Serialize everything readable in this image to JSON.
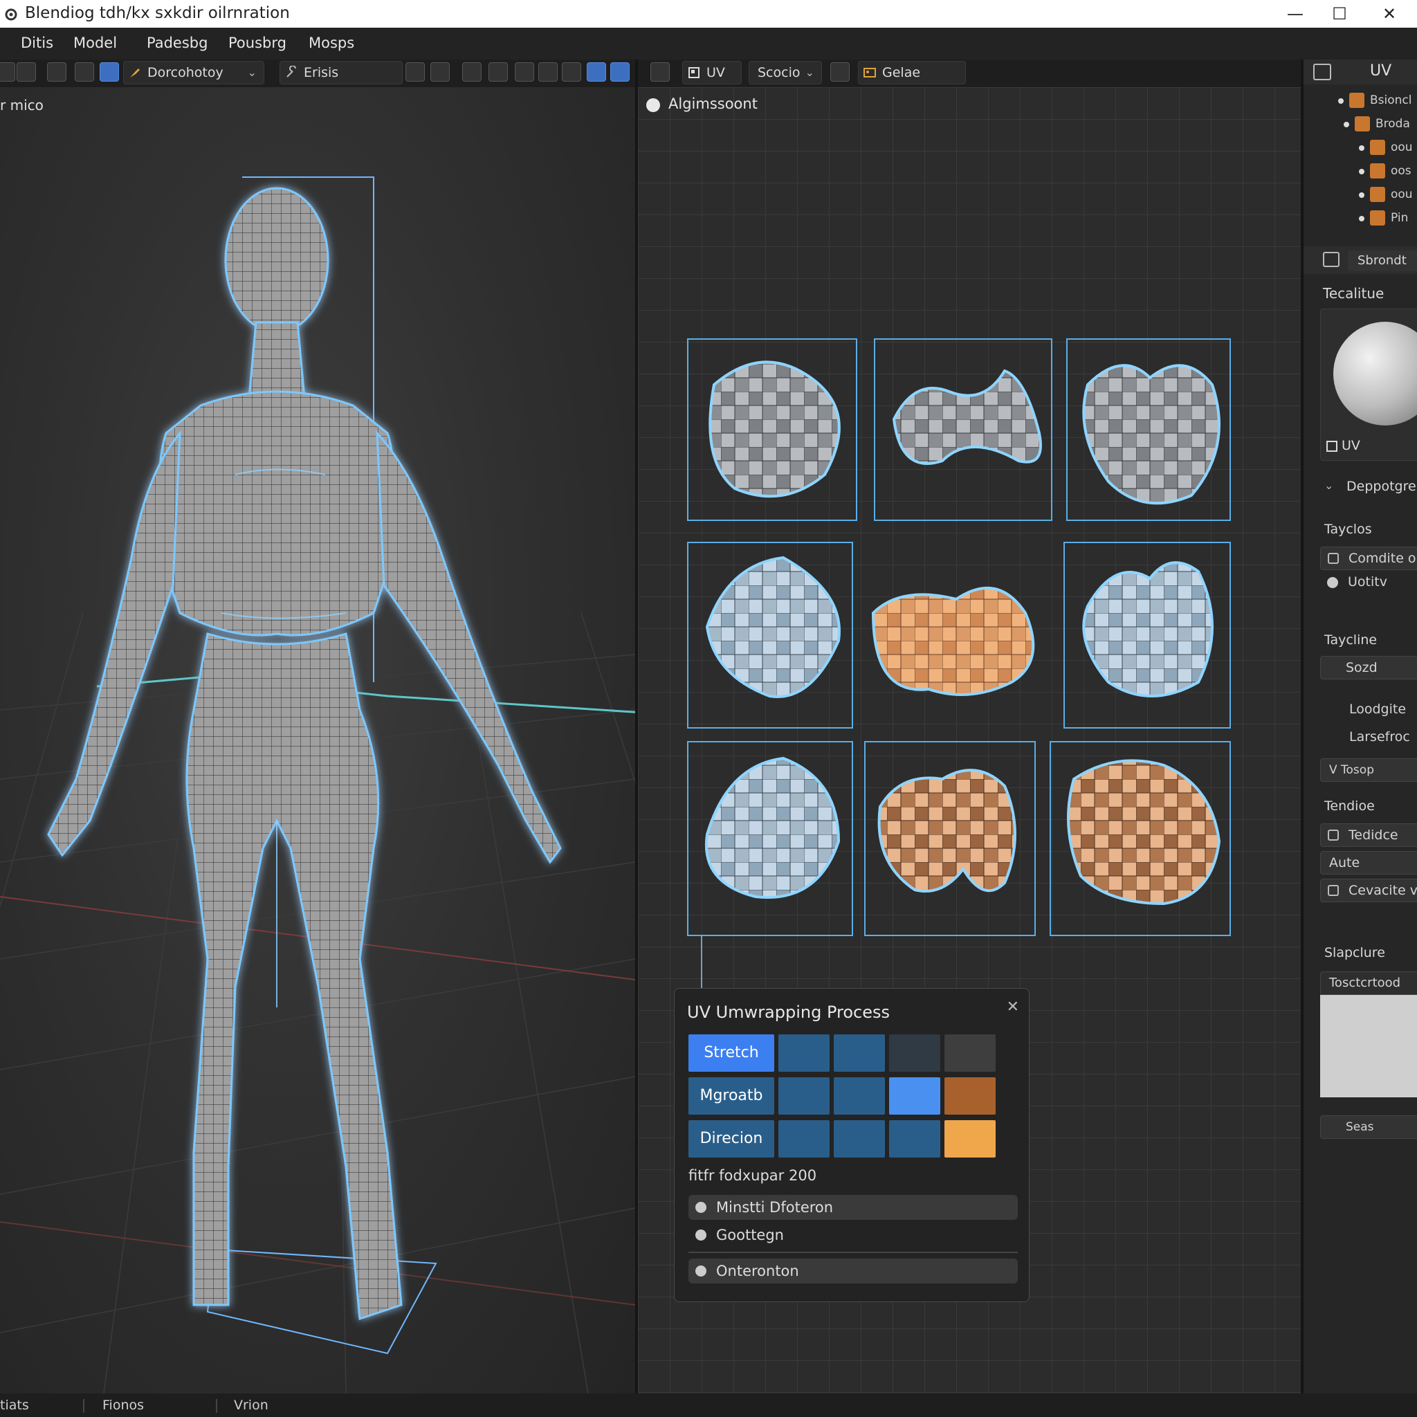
{
  "window": {
    "title": "Blendiog tdh/kx sxkdir oilrnration",
    "minimize": "—",
    "maximize": "☐",
    "close": "✕"
  },
  "menu": [
    "Ditis",
    "Model",
    "Padesbg",
    "Pousbrg",
    "Mosps"
  ],
  "toolbar": {
    "mode_label": "Dorcohotoy",
    "tool_label": "Erisis",
    "uv_label": "UV",
    "select_label": "Scocio",
    "extra_label": "Gelae"
  },
  "viewport": {
    "label": "r mico"
  },
  "uv_editor": {
    "label": "Algimssoont"
  },
  "uv_panel": {
    "title": "UV Umwrapping Process",
    "rows": [
      "Stretch",
      "Mgroatb",
      "Direcion"
    ],
    "param_label": "fitfr fodxupar 200",
    "options": [
      "Minstti Dfoteron",
      "Goottegn",
      "Onteronton"
    ]
  },
  "right_panel": {
    "header_label": "UV",
    "outliner": [
      "Bsioncl",
      "Broda",
      "oou",
      "oos",
      "oou",
      "Pin"
    ],
    "props_tab": "Sbrondt",
    "texture_section": "Tecalitue",
    "uv_checkbox": "UV",
    "dropdown_section": "Deppotgre",
    "topics_section": "Tayclos",
    "topic_items": [
      "Comdite o",
      "Uotitv"
    ],
    "taycline_section": "Taycline",
    "taycline_items": [
      "Sozd",
      "Loodgite",
      "Larsefroc"
    ],
    "tosop": "V Tosop",
    "tendioe_section": "Tendioe",
    "tendioe_items": [
      "Tedidce",
      "Aute",
      "Cevacite ve"
    ],
    "slapture_section": "Slapclure",
    "texture_field": "Tosctcrtood",
    "seas_label": "Seas"
  },
  "status": [
    "tiats",
    "Fionos",
    "Vrion"
  ],
  "colors": {
    "accent_blue": "#3c7ff0",
    "island_blue_outline": "#6fc3ff",
    "skin_orange": "#d6956b",
    "mesh_gray": "#a8a8a8"
  }
}
